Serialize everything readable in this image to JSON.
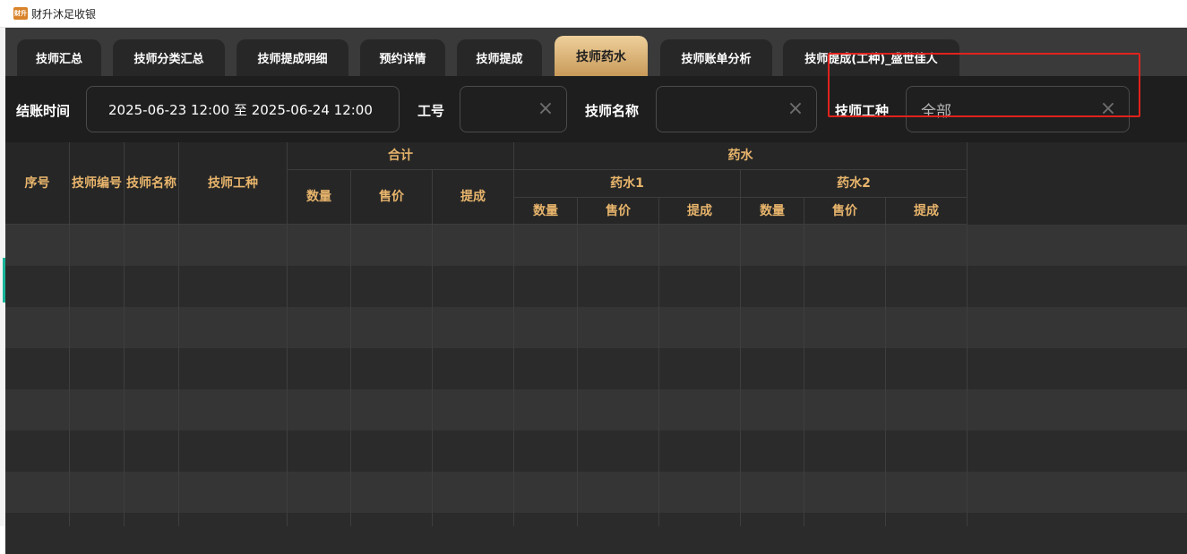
{
  "window": {
    "title": "财升沐足收银",
    "icon_text": "财升"
  },
  "tabs": [
    {
      "label": "技师汇总",
      "active": false
    },
    {
      "label": "技师分类汇总",
      "active": false
    },
    {
      "label": "技师提成明细",
      "active": false
    },
    {
      "label": "预约详情",
      "active": false
    },
    {
      "label": "技师提成",
      "active": false
    },
    {
      "label": "技师药水",
      "active": true
    },
    {
      "label": "技师账单分析",
      "active": false
    },
    {
      "label": "技师提成(工种)_盛世佳人",
      "active": false
    }
  ],
  "filters": {
    "checkout_time": {
      "label": "结账时间",
      "value": "2025-06-23 12:00 至 2025-06-24 12:00"
    },
    "employee_id": {
      "label": "工号",
      "value": ""
    },
    "tech_name": {
      "label": "技师名称",
      "value": ""
    },
    "tech_type": {
      "label": "技师工种",
      "value": "全部"
    }
  },
  "table": {
    "columns": {
      "seq": "序号",
      "tech_code": "技师编号",
      "tech_name": "技师名称",
      "tech_type": "技师工种",
      "total_group": "合计",
      "potion_group": "药水",
      "potion1": "药水1",
      "potion2": "药水2",
      "qty": "数量",
      "price": "售价",
      "commission": "提成"
    },
    "rows": []
  },
  "colors": {
    "accent": "#e8b56c",
    "active_tab": "#d9ae6b",
    "highlight": "#e0221c"
  }
}
